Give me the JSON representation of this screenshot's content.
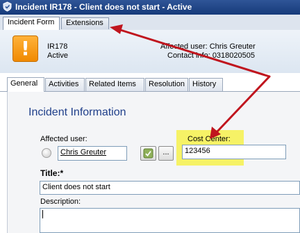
{
  "window": {
    "title": "Incident IR178 - Client does not start - Active"
  },
  "form_tabs": [
    {
      "label": "Incident Form",
      "active": true
    },
    {
      "label": "Extensions",
      "active": false
    }
  ],
  "header": {
    "id": "IR178",
    "status": "Active",
    "affected_user": "Affected user: Chris Greuter",
    "contact_info": "Contact info: 0318020505"
  },
  "sub_tabs": [
    {
      "label": "General",
      "active": true
    },
    {
      "label": "Activities",
      "active": false
    },
    {
      "label": "Related Items",
      "active": false
    },
    {
      "label": "Resolution",
      "active": false
    },
    {
      "label": "History",
      "active": false
    }
  ],
  "general": {
    "section_title": "Incident Information",
    "affected_user_label": "Affected user:",
    "affected_user_value": "Chris Greuter",
    "browse_label": "...",
    "cost_center_label": "Cost Center:",
    "cost_center_value": "123456",
    "title_label": "Title:*",
    "title_value": "Client does not start",
    "description_label": "Description:",
    "description_value": ""
  },
  "colors": {
    "annotation_arrow": "#c0151e",
    "highlight": "#f6f266",
    "section_title": "#1f3f8a",
    "alert_icon": "#f08a00"
  }
}
